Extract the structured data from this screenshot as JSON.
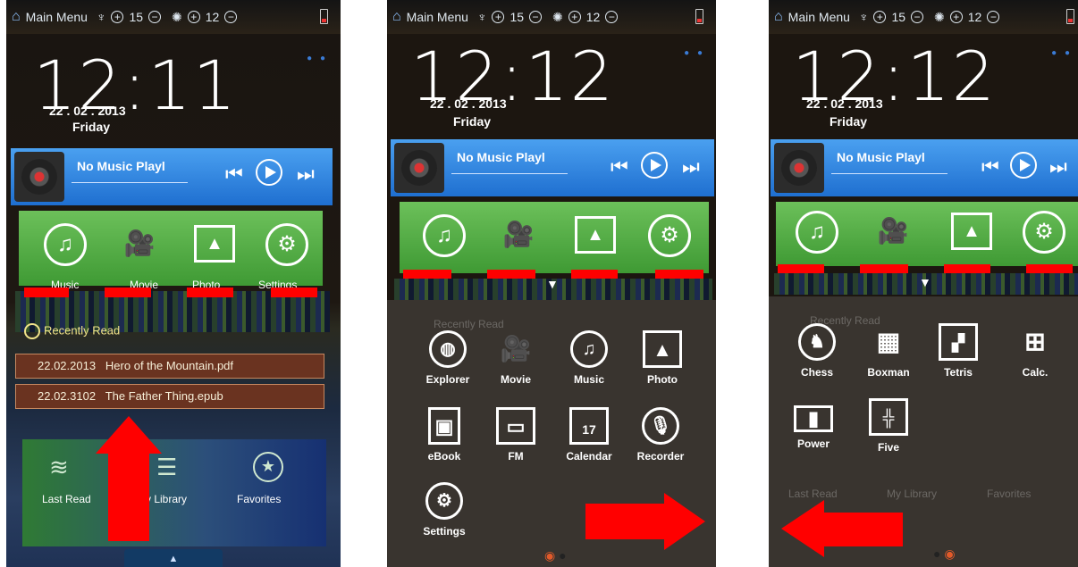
{
  "status": {
    "menu_label": "Main Menu",
    "volume": "15",
    "brightness": "12",
    "plus": "+",
    "minus": "−",
    "home_icon": "home-icon",
    "volume_icon": "volume-icon",
    "brightness_icon": "brightness-icon"
  },
  "panels": [
    {
      "time": "12:11",
      "date": "22 . 02 . 2013",
      "day": "Friday"
    },
    {
      "time": "12:12",
      "date": "22 . 02 . 2013",
      "day": "Friday"
    },
    {
      "time": "12:12",
      "date": "22 . 02 . 2013",
      "day": "Friday"
    }
  ],
  "music": {
    "title": "No Music Playl",
    "prev": "⏮",
    "next": "⏭"
  },
  "categories": [
    "Music",
    "Movie",
    "Photo",
    "Settings"
  ],
  "recently_read": {
    "title": "Recently Read",
    "books": [
      {
        "date": "22.02.2013",
        "name": "Hero of the Mountain.pdf"
      },
      {
        "date": "22.02.3102",
        "name": "The Father Thing.epub"
      }
    ]
  },
  "bottom_nav": [
    "Last Read",
    "My Library",
    "Favorites"
  ],
  "apps_page1": [
    "Explorer",
    "Movie",
    "Music",
    "Photo",
    "eBook",
    "FM",
    "Calendar",
    "Recorder",
    "Settings"
  ],
  "apps_page2": [
    "Chess",
    "Boxman",
    "Tetris",
    "Calc.",
    "Power",
    "Five"
  ],
  "calendar_day": "17",
  "colors": {
    "annotation": "#ff0000",
    "music_bar": "#2f86e6",
    "green_row": "#58ad46"
  }
}
